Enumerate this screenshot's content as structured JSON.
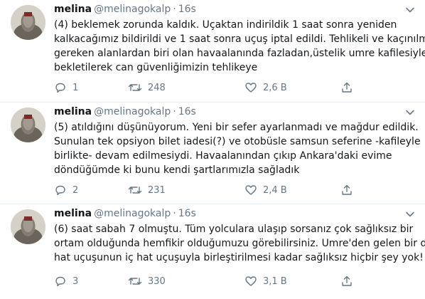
{
  "tweets": [
    {
      "name": "melina",
      "handle": "@melinagokalp",
      "dot": "·",
      "time": "16s",
      "lines": [
        "(4) beklemek zorunda kaldık. Uçaktan indirildik 1 saat sonra yeniden",
        "kalkacağımız bildirildi ve 1 saat sonra uçuş iptal edildi. Tehlikeli ve kaçınılması",
        "gereken alanlardan biri olan havaalanında fazladan,üstelik umre kafilesiyle",
        "bekletilerek can güvenliğimizin tehlikeye"
      ],
      "reply_count": "1",
      "retweet_count": "248",
      "like_count": "2,6 B"
    },
    {
      "name": "melina",
      "handle": "@melinagokalp",
      "dot": "·",
      "time": "16s",
      "lines": [
        "(5) atıldığını düşünüyorum. Yeni bir sefer ayarlanmadı ve mağdur edildik.",
        "Sunulan tek opsiyon bilet iadesi(?) ve otobüsle samsun seferine -kafileyle",
        "birlikte- devam edilmesiydi. Havaalanından çıkıp Ankara'daki evime",
        "döndüğümde ki bunu kendi şartlarımızla sağladık"
      ],
      "reply_count": "2",
      "retweet_count": "231",
      "like_count": "2,4 B"
    },
    {
      "name": "melina",
      "handle": "@melinagokalp",
      "dot": "·",
      "time": "16s",
      "lines": [
        "(6) saat sabah 7 olmuştu. Tüm yolculara ulaşıp sorsanız çok sağlıksız bir",
        "ortam olduğunda hemfikir olduğumuzu görebilirsiniz. Umre'den gelen bir dış",
        "hat uçuşunun iç hat uçuşuyla birleştirilmesi kadar sağlıksız hiçbir şey yok!"
      ],
      "reply_count": "3",
      "retweet_count": "330",
      "like_count": "3,1 B"
    }
  ],
  "icons": {
    "reply": "reply-icon",
    "retweet": "retweet-icon",
    "like": "heart-icon",
    "share": "share-icon",
    "caret": "chevron-down-icon"
  },
  "colors": {
    "muted": "#657786",
    "text": "#14171a",
    "divider": "#e6ecf0"
  }
}
